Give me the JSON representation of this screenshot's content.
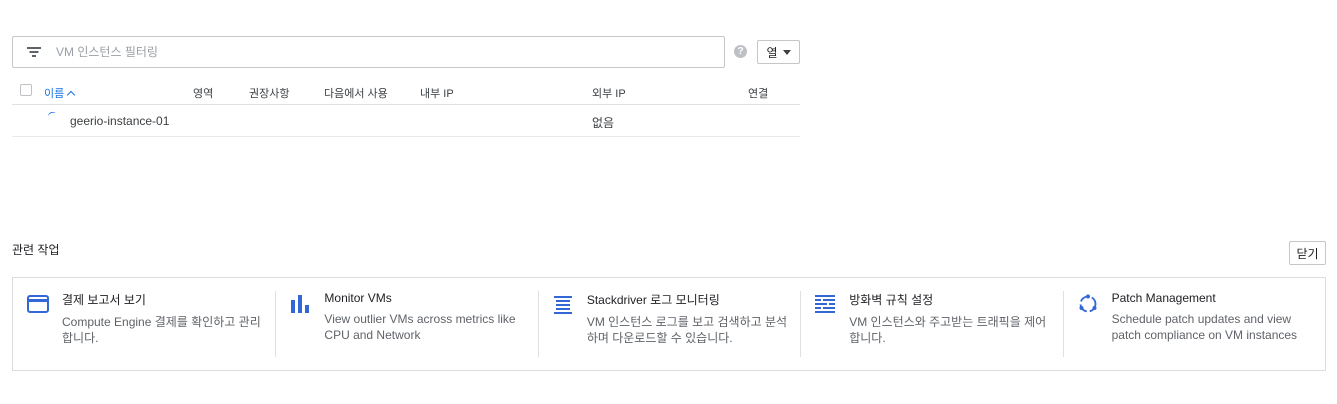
{
  "filter": {
    "placeholder": "VM 인스턴스 필터링"
  },
  "help_icon": "help-icon",
  "columns_button": {
    "label": "열"
  },
  "table": {
    "headers": {
      "name": "이름",
      "zone": "영역",
      "recommendation": "권장사항",
      "in_use_by": "다음에서 사용",
      "internal_ip": "내부 IP",
      "external_ip": "외부 IP",
      "connect": "연결"
    },
    "rows": [
      {
        "name": "geerio-instance-01",
        "external_ip": "없음",
        "status_icon": "loading-spinner-icon"
      }
    ]
  },
  "related": {
    "title": "관련 작업",
    "close_label": "닫기",
    "cards": [
      {
        "icon": "credit-card-icon",
        "title": "결제 보고서 보기",
        "desc": "Compute Engine 결제를 확인하고 관리합니다."
      },
      {
        "icon": "bar-chart-icon",
        "title": "Monitor VMs",
        "desc": "View outlier VMs across metrics like CPU and Network"
      },
      {
        "icon": "logs-icon",
        "title": "Stackdriver 로그 모니터링",
        "desc": "VM 인스턴스 로그를 보고 검색하고 분석하며 다운로드할 수 있습니다."
      },
      {
        "icon": "firewall-icon",
        "title": "방화벽 규칙 설정",
        "desc": "VM 인스턴스와 주고받는 트래픽을 제어합니다."
      },
      {
        "icon": "patch-sync-icon",
        "title": "Patch Management",
        "desc": "Schedule patch updates and view patch compliance on VM instances"
      }
    ]
  },
  "colors": {
    "accent": "#1a73e8",
    "icon_blue": "#3367d6",
    "border": "#dadce0"
  }
}
